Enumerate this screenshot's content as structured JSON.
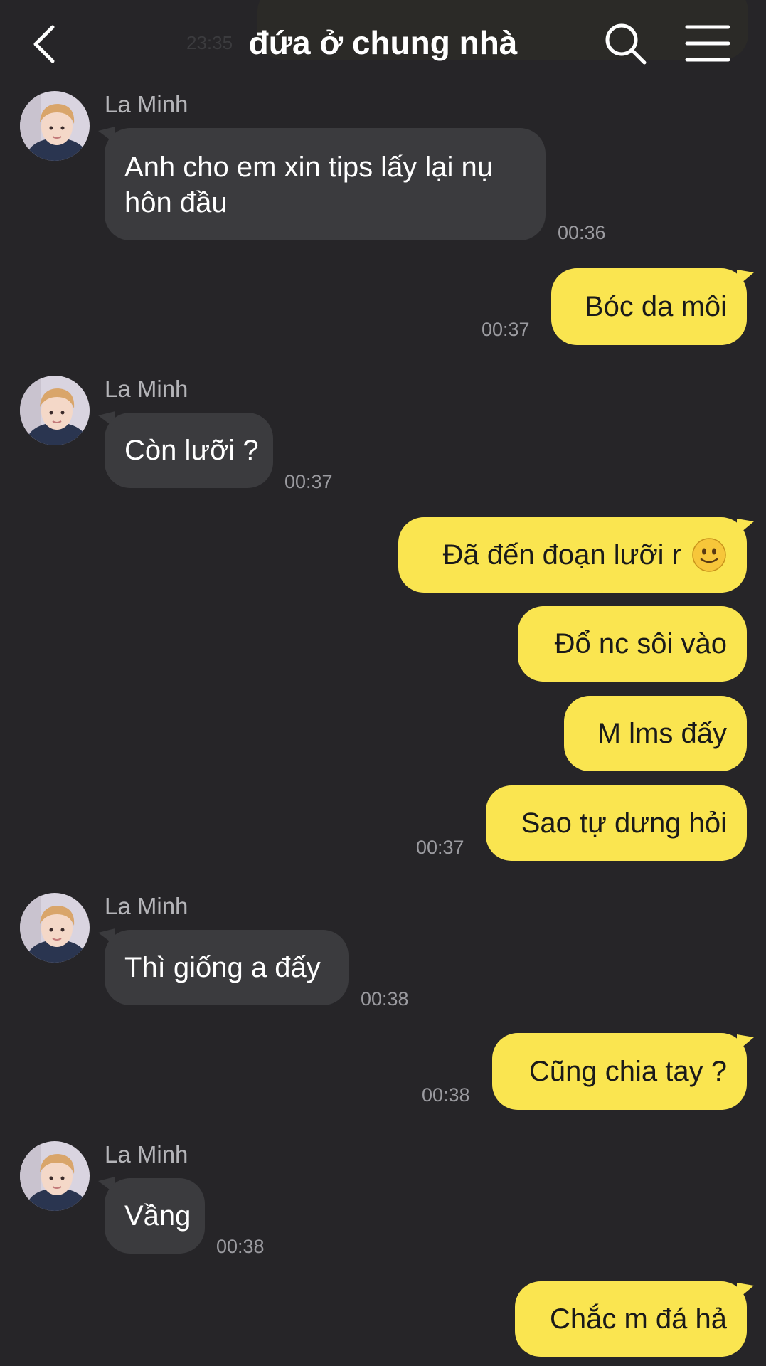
{
  "header": {
    "title": "đứa ở chung nhà",
    "ghost_time": "23:35"
  },
  "colors": {
    "background": "#262528",
    "incoming_bubble": "#3b3b3e",
    "outgoing_bubble": "#fae550",
    "timestamp": "#9b9ba0"
  },
  "icons": {
    "back": "chevron-left-icon",
    "search": "search-icon",
    "menu": "hamburger-menu-icon",
    "emoji": "slightly-smiling-face-emoji"
  },
  "messages": {
    "m1": {
      "sender": "La Minh",
      "text": "Anh cho em xin tips lấy lại nụ hôn đầu",
      "time": "00:36"
    },
    "m2": {
      "text": "Bóc da môi",
      "time": "00:37"
    },
    "m3": {
      "sender": "La Minh",
      "text": "Còn lưỡi ?",
      "time": "00:37"
    },
    "m4": {
      "text": "Đã đến đoạn lưỡi r"
    },
    "m5": {
      "text": "Đổ nc sôi vào"
    },
    "m6": {
      "text": "M lms đấy"
    },
    "m7": {
      "text": "Sao tự dưng hỏi",
      "time": "00:37"
    },
    "m8": {
      "sender": "La Minh",
      "text": "Thì giống a đấy",
      "time": "00:38"
    },
    "m9": {
      "text": "Cũng chia tay ?",
      "time": "00:38"
    },
    "m10": {
      "sender": "La Minh",
      "text": "Vầng",
      "time": "00:38"
    },
    "m11": {
      "text": "Chắc m đá hả"
    }
  }
}
